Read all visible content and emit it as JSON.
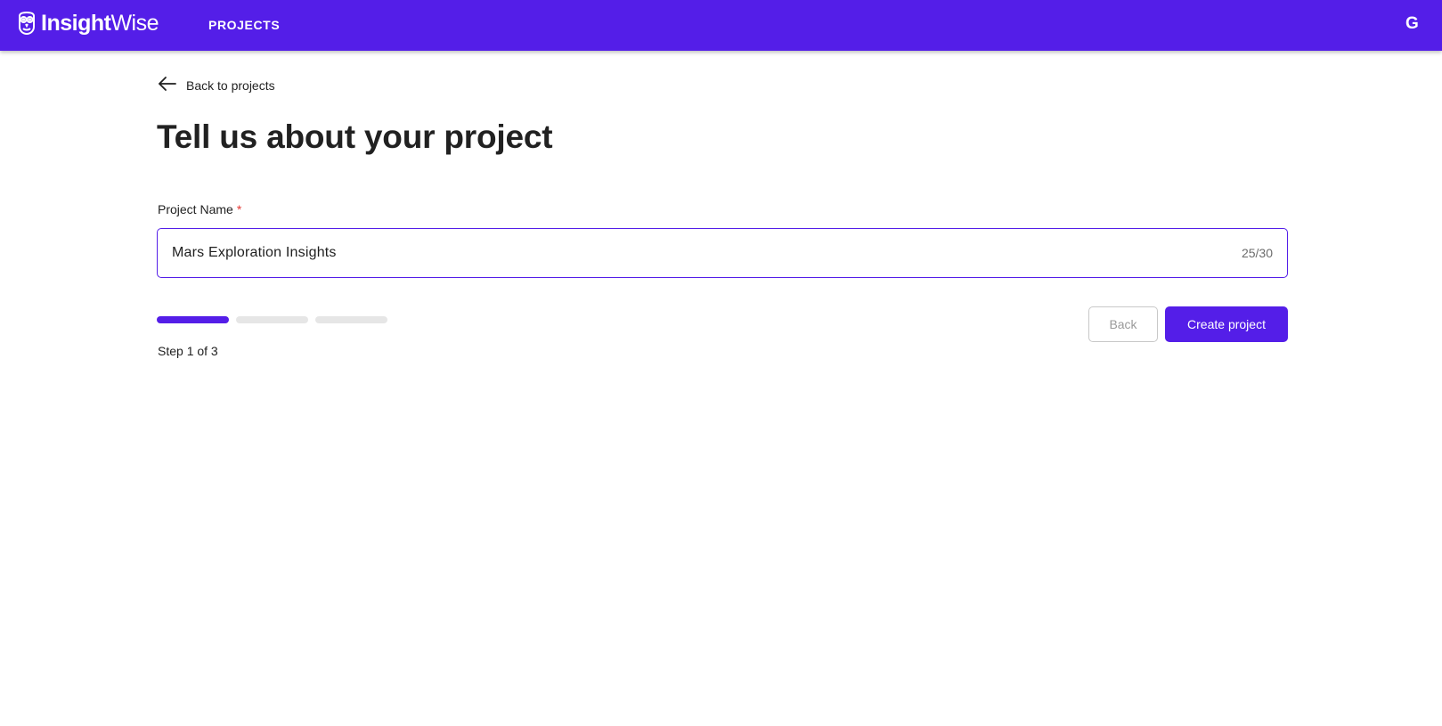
{
  "brand": {
    "name_bold": "Insight",
    "name_light": "Wise",
    "logo_icon": "owl-logo-icon",
    "color": "#541ee8"
  },
  "nav": {
    "projects_label": "PROJECTS",
    "user_initial": "G"
  },
  "back_link": {
    "icon": "arrow-left-icon",
    "label": "Back to projects"
  },
  "page": {
    "title": "Tell us about your project"
  },
  "form": {
    "project_name": {
      "label": "Project Name",
      "required_marker": "*",
      "value": "Mars Exploration Insights",
      "counter": "25/30"
    }
  },
  "stepper": {
    "total_steps": 3,
    "current_step": 1,
    "step_text": "Step 1 of 3"
  },
  "actions": {
    "back_label": "Back",
    "create_label": "Create project"
  }
}
